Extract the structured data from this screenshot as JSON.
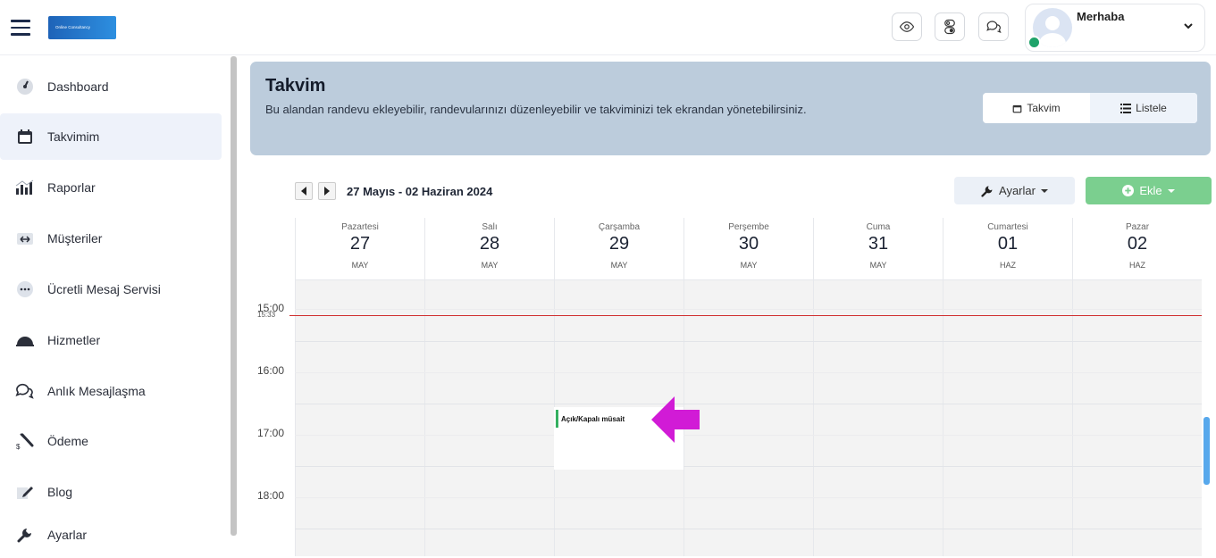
{
  "header": {
    "logo_text": "Online Consultancy",
    "greeting": "Merhaba",
    "icons": [
      "eye-icon",
      "toggle-icon",
      "chat-icon"
    ]
  },
  "sidebar": {
    "items": [
      {
        "label": "Dashboard",
        "icon": "speedometer-icon",
        "active": false
      },
      {
        "label": "Takvimim",
        "icon": "calendar-icon",
        "active": true
      },
      {
        "label": "Raporlar",
        "icon": "bar-chart-icon",
        "active": false
      },
      {
        "label": "Müşteriler",
        "icon": "users-icon",
        "active": false
      },
      {
        "label": "Ücretli Mesaj Servisi",
        "icon": "ellipsis-bubble-icon",
        "active": false
      },
      {
        "label": "Hizmetler",
        "icon": "dome-icon",
        "active": false
      },
      {
        "label": "Anlık Mesajlaşma",
        "icon": "chat-bubbles-icon",
        "active": false
      },
      {
        "label": "Ödeme",
        "icon": "payment-icon",
        "active": false
      },
      {
        "label": "Blog",
        "icon": "pencil-icon",
        "active": false
      },
      {
        "label": "Ayarlar",
        "icon": "wrench-icon",
        "active": false
      }
    ]
  },
  "banner": {
    "title": "Takvim",
    "description": "Bu alandan randevu ekleyebilir, randevularınızı düzenleyebilir ve takviminizi tek ekrandan yönetebilirsiniz.",
    "view_calendar": "Takvim",
    "view_list": "Listele"
  },
  "toolbar": {
    "range": "27 Mayıs - 02 Haziran 2024",
    "settings": "Ayarlar",
    "add": "Ekle"
  },
  "calendar": {
    "days": [
      {
        "name": "Pazartesi",
        "date": "27",
        "month": "MAY"
      },
      {
        "name": "Salı",
        "date": "28",
        "month": "MAY"
      },
      {
        "name": "Çarşamba",
        "date": "29",
        "month": "MAY"
      },
      {
        "name": "Perşembe",
        "date": "30",
        "month": "MAY"
      },
      {
        "name": "Cuma",
        "date": "31",
        "month": "MAY"
      },
      {
        "name": "Cumartesi",
        "date": "01",
        "month": "HAZ"
      },
      {
        "name": "Pazar",
        "date": "02",
        "month": "HAZ"
      }
    ],
    "times": [
      "15:00",
      "16:00",
      "17:00",
      "18:00"
    ],
    "now_label": "15:33",
    "event": {
      "title": "Açık/Kapalı müsait",
      "day": "Çarşamba",
      "time": "17:00",
      "accent": "#35b060"
    }
  },
  "colors": {
    "banner_bg": "#bcccdc",
    "add_button": "#7bcf8f",
    "now_line": "#d02f2f",
    "pointer_arrow": "#d11bd6"
  }
}
